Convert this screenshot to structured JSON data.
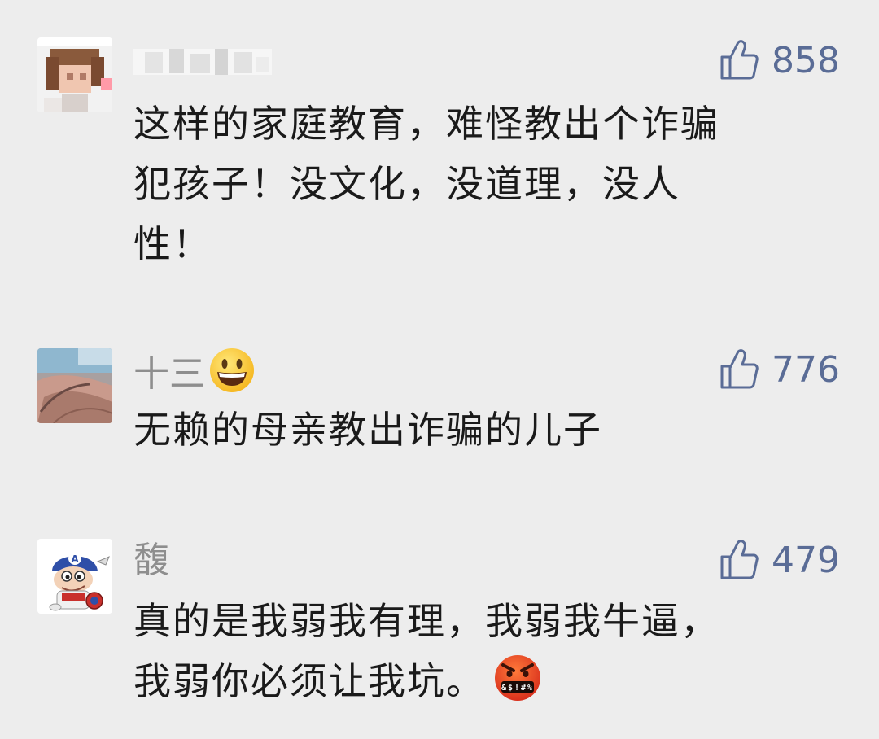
{
  "comments": [
    {
      "username": "",
      "likes": "858",
      "text_lines": [
        "这样的家庭教育，难怪教出个诈骗",
        "犯孩子！没文化，没道理，没人",
        "性！"
      ]
    },
    {
      "username": "十三",
      "name_emoji": "grinning-face-emoji",
      "likes": "776",
      "text_lines": [
        "无赖的母亲教出诈骗的儿子"
      ]
    },
    {
      "username": "馥",
      "likes": "479",
      "text_lines": [
        "真的是我弱我有理，我弱我牛逼，",
        "我弱你必须让我坑。"
      ],
      "text_emoji": "cursing-face-emoji",
      "text_emoji_symbols": "&$!#%"
    }
  ],
  "icons": {
    "like": "thumbs-up-outline-icon"
  },
  "colors": {
    "background": "#ededed",
    "username": "#8e8e8e",
    "like": "#5a6c96",
    "body_text": "#1a1a1a"
  }
}
